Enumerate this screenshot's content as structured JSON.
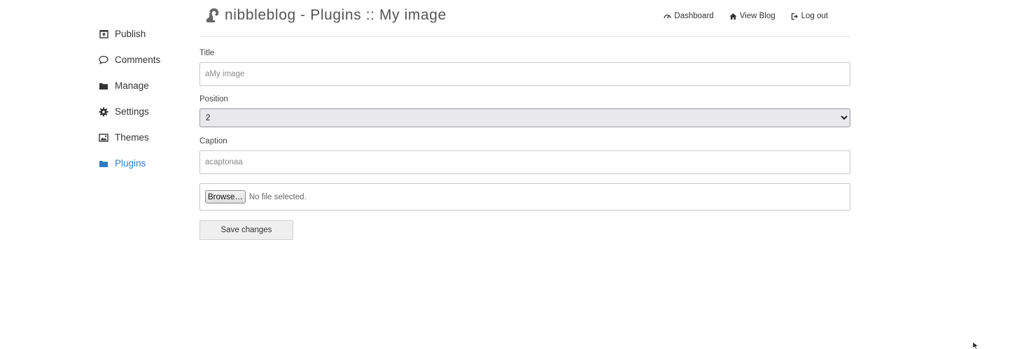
{
  "sidebar": {
    "items": [
      {
        "label": "Publish",
        "icon": "publish-icon"
      },
      {
        "label": "Comments",
        "icon": "comment-icon"
      },
      {
        "label": "Manage",
        "icon": "folder-icon"
      },
      {
        "label": "Settings",
        "icon": "gear-icon"
      },
      {
        "label": "Themes",
        "icon": "image-icon"
      },
      {
        "label": "Plugins",
        "icon": "folder-icon",
        "active": true
      }
    ],
    "active_color": "#2f7cc4"
  },
  "header": {
    "title": "nibbleblog - Plugins :: My image",
    "logo_icon": "squirrel-logo-icon",
    "nav": {
      "dashboard": "Dashboard",
      "view_blog": "View Blog",
      "logout": "Log out"
    }
  },
  "form": {
    "title_label": "Title",
    "title_value": "aMy image",
    "position_label": "Position",
    "position_selected": "2",
    "caption_label": "Caption",
    "caption_value": "acaptonaa",
    "file_button": "Browse…",
    "file_status": "No file selected.",
    "save_button": "Save changes"
  }
}
